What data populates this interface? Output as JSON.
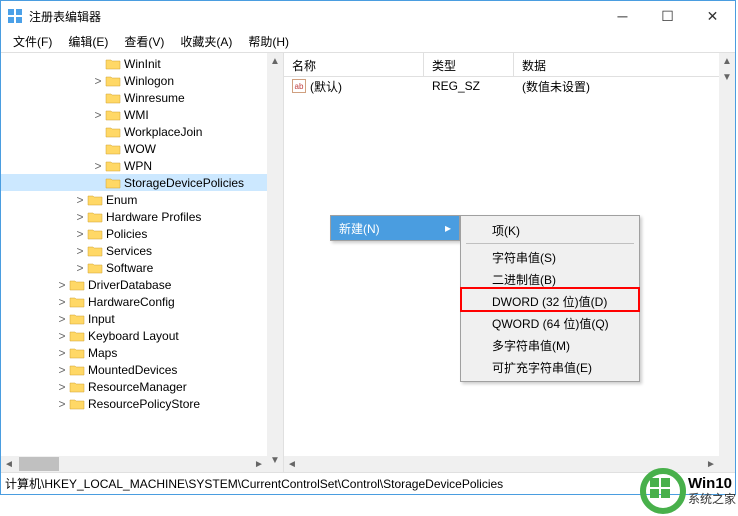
{
  "window": {
    "title": "注册表编辑器"
  },
  "menus": {
    "file": "文件(F)",
    "edit": "编辑(E)",
    "view": "查看(V)",
    "favorites": "收藏夹(A)",
    "help": "帮助(H)"
  },
  "tree": [
    {
      "indent": 5,
      "expander": "",
      "label": "WinInit"
    },
    {
      "indent": 5,
      "expander": ">",
      "label": "Winlogon"
    },
    {
      "indent": 5,
      "expander": "",
      "label": "Winresume"
    },
    {
      "indent": 5,
      "expander": ">",
      "label": "WMI"
    },
    {
      "indent": 5,
      "expander": "",
      "label": "WorkplaceJoin"
    },
    {
      "indent": 5,
      "expander": "",
      "label": "WOW"
    },
    {
      "indent": 5,
      "expander": ">",
      "label": "WPN"
    },
    {
      "indent": 5,
      "expander": "",
      "label": "StorageDevicePolicies",
      "selected": true
    },
    {
      "indent": 4,
      "expander": ">",
      "label": "Enum"
    },
    {
      "indent": 4,
      "expander": ">",
      "label": "Hardware Profiles"
    },
    {
      "indent": 4,
      "expander": ">",
      "label": "Policies"
    },
    {
      "indent": 4,
      "expander": ">",
      "label": "Services"
    },
    {
      "indent": 4,
      "expander": ">",
      "label": "Software"
    },
    {
      "indent": 3,
      "expander": ">",
      "label": "DriverDatabase"
    },
    {
      "indent": 3,
      "expander": ">",
      "label": "HardwareConfig"
    },
    {
      "indent": 3,
      "expander": ">",
      "label": "Input"
    },
    {
      "indent": 3,
      "expander": ">",
      "label": "Keyboard Layout"
    },
    {
      "indent": 3,
      "expander": ">",
      "label": "Maps"
    },
    {
      "indent": 3,
      "expander": ">",
      "label": "MountedDevices"
    },
    {
      "indent": 3,
      "expander": ">",
      "label": "ResourceManager"
    },
    {
      "indent": 3,
      "expander": ">",
      "label": "ResourcePolicyStore"
    }
  ],
  "list": {
    "headers": {
      "name": "名称",
      "type": "类型",
      "data": "数据"
    },
    "rows": [
      {
        "name": "(默认)",
        "type": "REG_SZ",
        "data": "(数值未设置)"
      }
    ]
  },
  "context": {
    "new_label": "新建(N)",
    "submenu": [
      {
        "label": "项(K)",
        "sep_after": true
      },
      {
        "label": "字符串值(S)"
      },
      {
        "label": "二进制值(B)"
      },
      {
        "label": "DWORD (32 位)值(D)"
      },
      {
        "label": "QWORD (64 位)值(Q)"
      },
      {
        "label": "多字符串值(M)"
      },
      {
        "label": "可扩充字符串值(E)"
      }
    ]
  },
  "status": {
    "path": "计算机\\HKEY_LOCAL_MACHINE\\SYSTEM\\CurrentControlSet\\Control\\StorageDevicePolicies"
  },
  "watermark": {
    "line1": "Win10",
    "line2": "系统之家"
  }
}
